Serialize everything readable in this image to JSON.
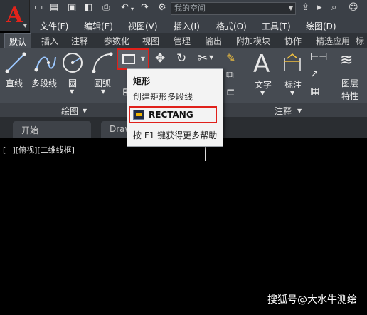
{
  "titlebar": {
    "workspace_placeholder": "我的空间"
  },
  "menubar": {
    "items": [
      "文件(F)",
      "编辑(E)",
      "视图(V)",
      "插入(I)",
      "格式(O)",
      "工具(T)",
      "绘图(D)"
    ]
  },
  "ribbon_tabs": {
    "items": [
      "默认",
      "插入",
      "注释",
      "参数化",
      "视图",
      "管理",
      "输出",
      "附加模块",
      "协作",
      "精选应用",
      "标注"
    ],
    "active": "默认"
  },
  "ribbon": {
    "draw_tools": [
      "直线",
      "多段线",
      "圆",
      "圆弧"
    ],
    "text_tool": "文字",
    "dim_tool": "标注",
    "layer_tool": [
      "图层",
      "特性"
    ],
    "panels": {
      "draw": "绘图",
      "annotation": "注释"
    }
  },
  "doc_tabs": {
    "start": "开始",
    "drawing": "Draw"
  },
  "viewport": {
    "label": "[−][俯视][二维线框]"
  },
  "tooltip": {
    "title": "矩形",
    "description": "创建矩形多段线",
    "command": "RECTANG",
    "help": "按 F1 键获得更多帮助"
  },
  "watermark": "搜狐号@大水牛测绘",
  "colors": {
    "accent": "#e0201a",
    "ribbon_bg": "#464b52",
    "canvas_bg": "#000000"
  }
}
